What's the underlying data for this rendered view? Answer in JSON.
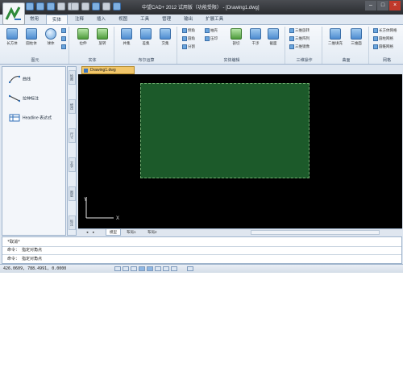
{
  "app": {
    "title": "中望CAD+ 2012 试用版（功能受限） - [Drawing1.dwg]"
  },
  "ribbon": {
    "tabs": [
      "常用",
      "实体",
      "注释",
      "插入",
      "视图",
      "工具",
      "管理",
      "输出",
      "扩展工具"
    ],
    "active_tab": "实体",
    "groups": [
      {
        "label": "图元",
        "buttons": [
          "长方体",
          "圆柱体",
          "球体"
        ]
      },
      {
        "label": "实体",
        "buttons": [
          "拉伸",
          "旋转"
        ]
      },
      {
        "label": "布尔运算",
        "buttons": [
          "并集",
          "差集",
          "交集"
        ]
      },
      {
        "label": "实体编辑",
        "buttons": [
          "倒角",
          "圆角",
          "分割",
          "抽壳",
          "压印",
          "剖切",
          "干涉",
          "截面"
        ]
      },
      {
        "label": "三维操作",
        "buttons": [
          "三维旋转",
          "三维阵列",
          "三维镜像"
        ]
      },
      {
        "label": "曲面",
        "buttons": [
          "二维填充",
          "三维面"
        ]
      },
      {
        "label": "网格",
        "buttons": [
          "长方体网格",
          "圆柱网格",
          "圆锥网格"
        ]
      }
    ]
  },
  "left_panel": {
    "items": [
      {
        "label": "曲线"
      },
      {
        "label": "拉伸标注"
      },
      {
        "label": "Headline 表达式"
      }
    ],
    "vertical_tabs": [
      "绘图",
      "修改",
      "尺寸",
      "文字",
      "图层",
      "标注"
    ]
  },
  "document": {
    "tab_label": "Drawing1.dwg"
  },
  "canvas": {
    "background": "#000000",
    "rect_fill": "#1c5a2a",
    "axis_x": "X",
    "axis_y": "Y"
  },
  "layout_tabs": [
    "模型",
    "布局1",
    "布局2"
  ],
  "active_layout": "模型",
  "command": {
    "lines": [
      "*取消*",
      "命令： 指定对角点",
      "命令： 指定对角点"
    ]
  },
  "status": {
    "coordinates": "426.0609,  788.4991,  0.0000"
  }
}
